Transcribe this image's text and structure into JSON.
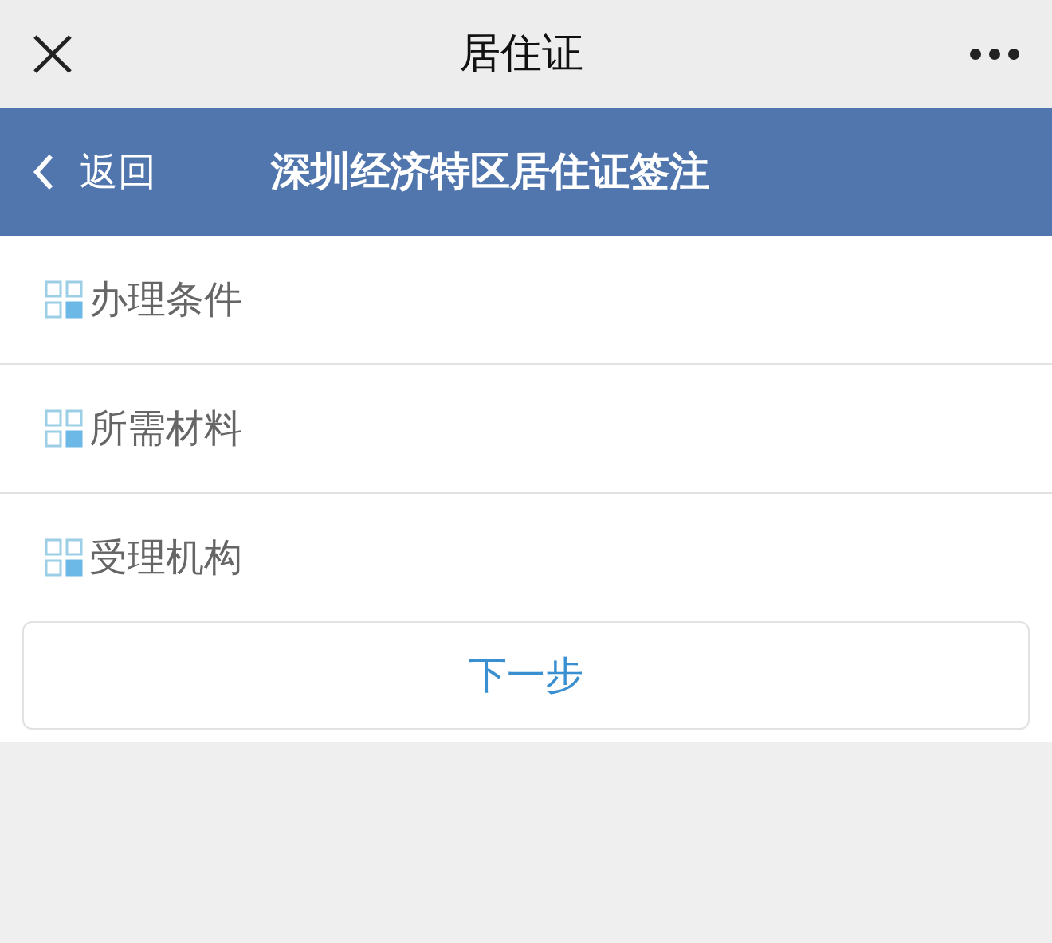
{
  "window": {
    "title": "居住证"
  },
  "header": {
    "back": "返回",
    "title": "深圳经济特区居住证签注"
  },
  "items": [
    {
      "label": "办理条件"
    },
    {
      "label": "所需材料"
    },
    {
      "label": "受理机构"
    }
  ],
  "next_button": "下一步"
}
